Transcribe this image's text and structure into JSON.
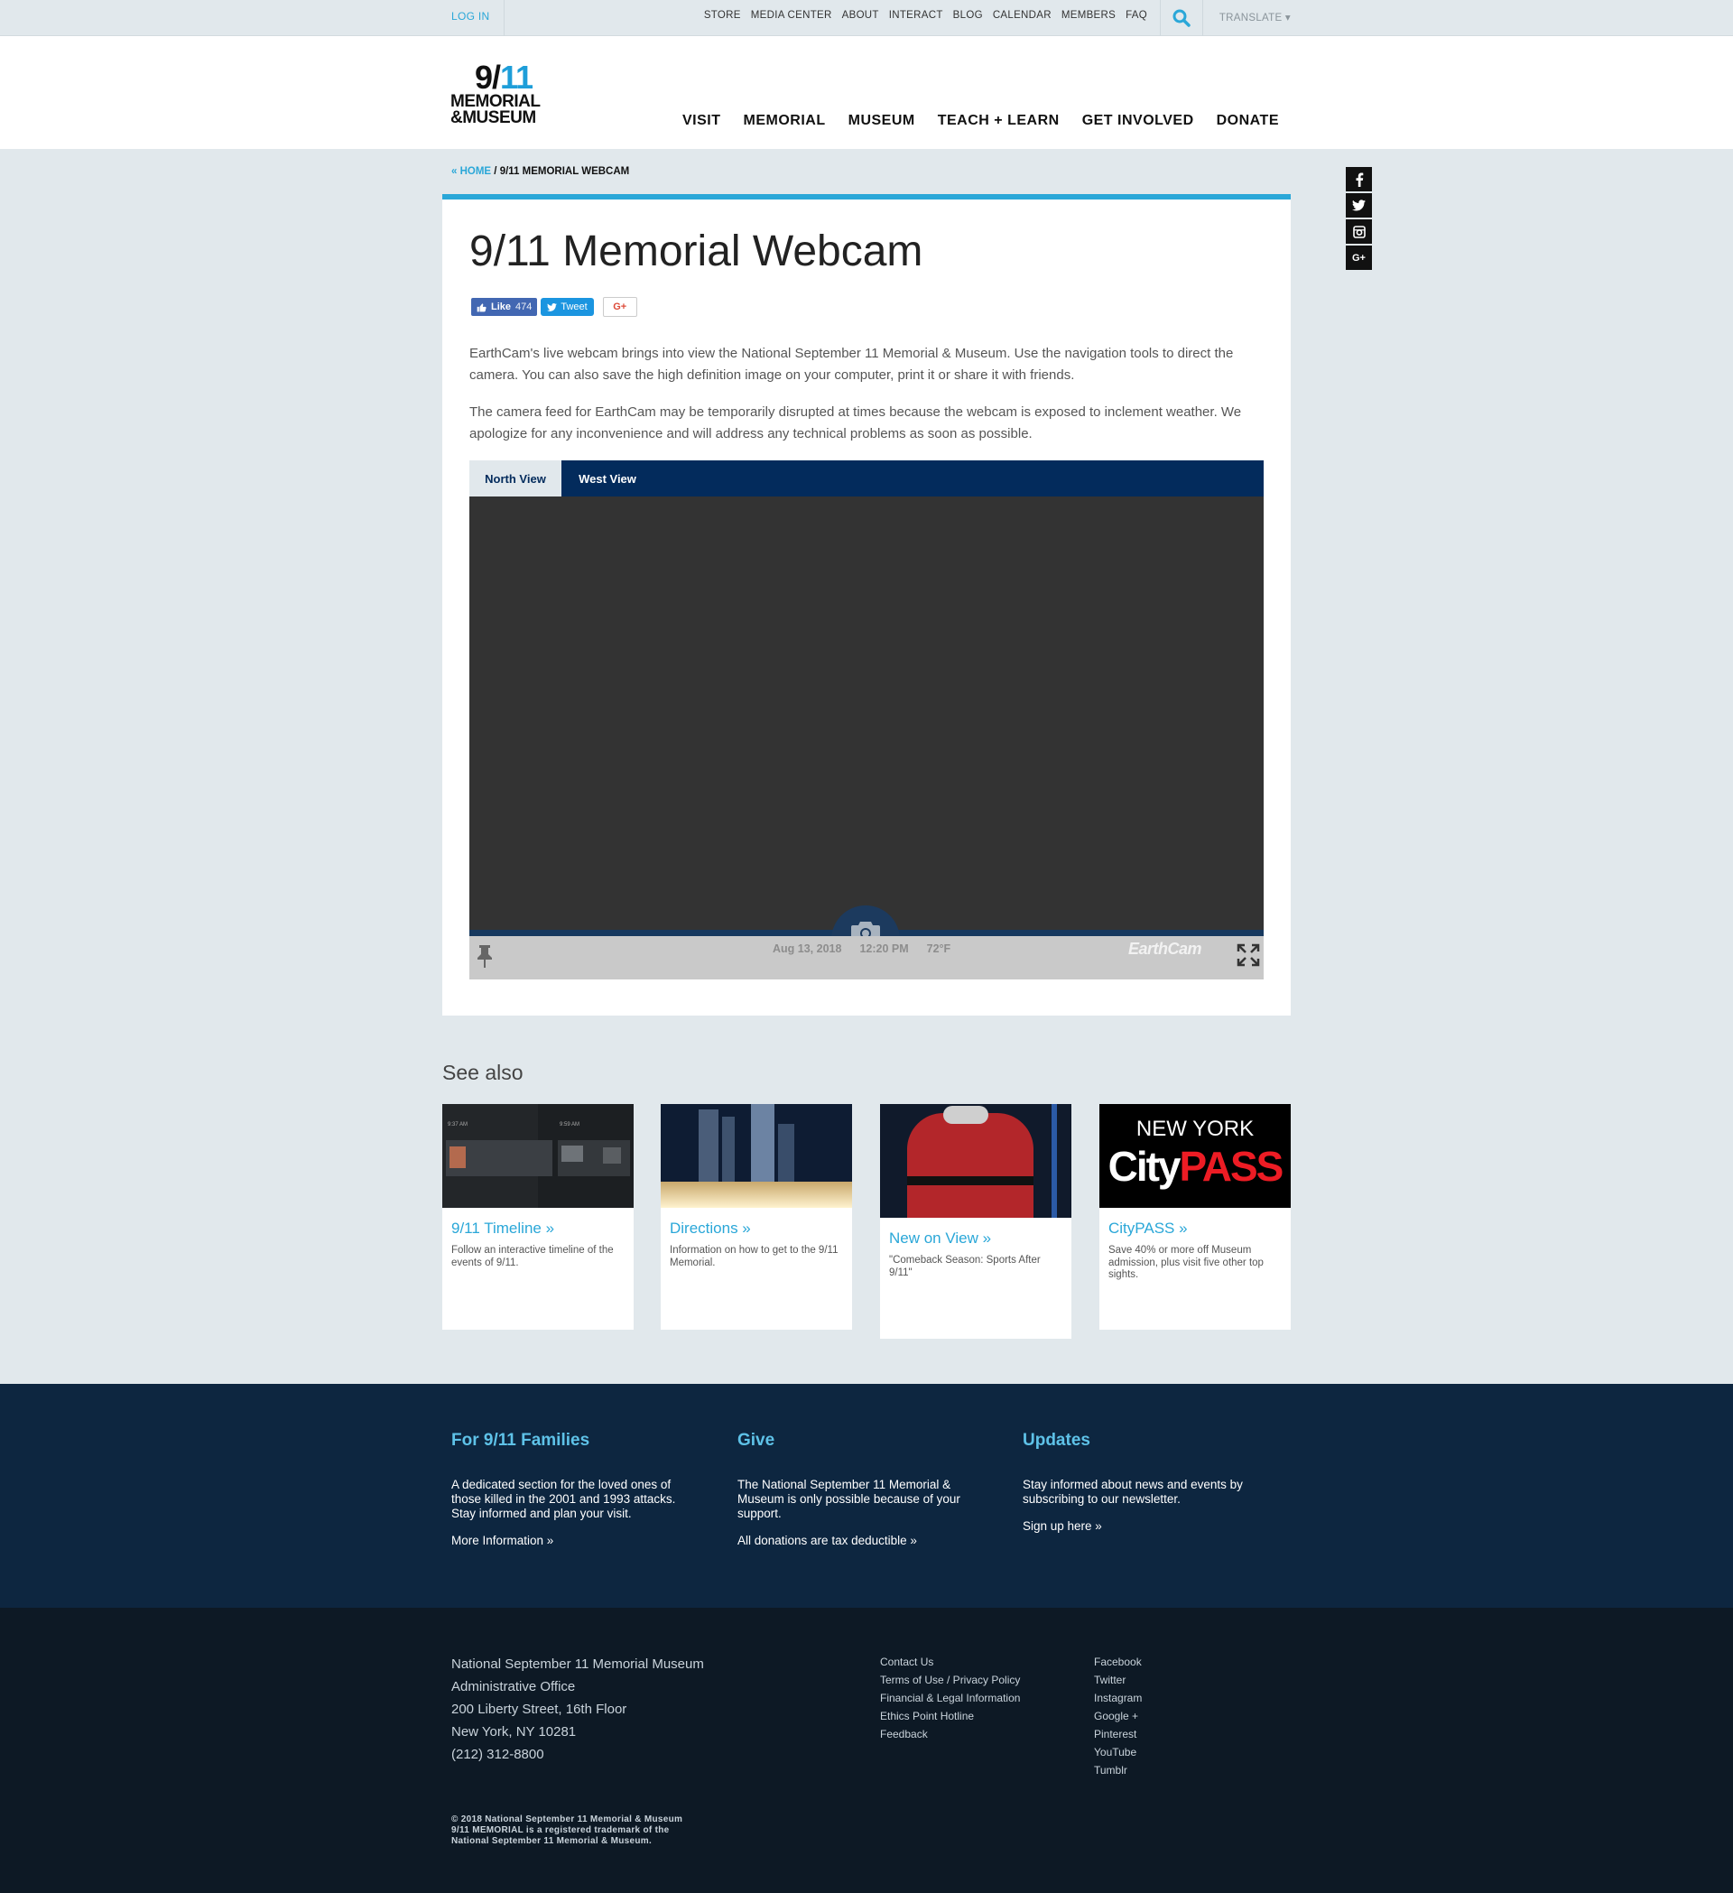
{
  "util": {
    "login": "LOG IN",
    "links": [
      "STORE",
      "MEDIA CENTER",
      "ABOUT",
      "INTERACT",
      "BLOG",
      "CALENDAR",
      "MEMBERS",
      "FAQ"
    ],
    "translate": "TRANSLATE ▾"
  },
  "logo": {
    "num_a": "9/",
    "num_b": "11",
    "line1": "MEMORIAL",
    "line2": "&MUSEUM"
  },
  "nav": [
    "VISIT",
    "MEMORIAL",
    "MUSEUM",
    "TEACH + LEARN",
    "GET INVOLVED",
    "DONATE"
  ],
  "breadcrumb": {
    "home": "« HOME",
    "sep": " / ",
    "current": "9/11 MEMORIAL WEBCAM"
  },
  "social": [
    "f",
    "t",
    "ig",
    "G+"
  ],
  "page": {
    "title": "9/11 Memorial Webcam",
    "share": {
      "like": "Like",
      "like_count": "474",
      "tweet": "Tweet",
      "gplus": "G+"
    },
    "p1": "EarthCam's live webcam brings into view the National September 11 Memorial & Museum. Use the navigation tools to direct the camera. You can also save the high definition image on your computer, print it or share it with friends.",
    "p2": "The camera feed for EarthCam may be temporarily disrupted at times because the webcam is exposed to inclement weather. We apologize for any inconvenience and will address any technical problems as soon as possible."
  },
  "webcam": {
    "tabs": [
      "North View",
      "West View"
    ],
    "active_tab": "North View",
    "date": "Aug 13, 2018",
    "time": "12:20 PM",
    "temp": "72°F",
    "brand": "EarthCam"
  },
  "see_also": {
    "heading": "See also",
    "cards": [
      {
        "title": "9/11 Timeline »",
        "desc": "Follow an interactive timeline of the events of 9/11."
      },
      {
        "title": "Directions »",
        "desc": "Information on how to get to the 9/11 Memorial."
      },
      {
        "title": "New on View »",
        "desc": "\"Comeback Season: Sports After 9/11\""
      },
      {
        "title": "CityPASS »",
        "desc": "Save 40% or more off Museum admission, plus visit five other top sights.",
        "logo_top": "NEW YORK",
        "logo_city": "City",
        "logo_pass": "PASS"
      }
    ],
    "timeline_thumb": {
      "t1": "9:37 AM",
      "t2": "9:59 AM"
    }
  },
  "families": [
    {
      "title": "For 9/11 Families",
      "text": "A dedicated section for the loved ones of those killed in the 2001 and 1993 attacks. Stay informed and plan your visit.",
      "link": "More Information »"
    },
    {
      "title": "Give",
      "text": "The National September 11 Memorial & Museum is only possible because of your support.",
      "link": "All donations are tax deductible »"
    },
    {
      "title": "Updates",
      "text": "Stay informed about news and events by subscribing to our newsletter.",
      "link": "Sign up here »"
    }
  ],
  "footer": {
    "address": [
      "National September 11 Memorial Museum",
      "Administrative Office",
      "200 Liberty Street, 16th Floor",
      "New York, NY 10281",
      "(212) 312-8800"
    ],
    "links1": [
      "Contact Us",
      "Terms of Use / Privacy Policy",
      "Financial & Legal Information",
      "Ethics Point Hotline",
      "Feedback"
    ],
    "links2": [
      "Facebook",
      "Twitter",
      "Instagram",
      "Google +",
      "Pinterest",
      "YouTube",
      "Tumblr"
    ],
    "copyright": [
      "© 2018 National September 11 Memorial & Museum",
      "9/11 MEMORIAL is a registered trademark of the",
      "National September 11 Memorial & Museum."
    ]
  },
  "colors": {
    "accent": "#2aa7d8",
    "navy": "#032b5c",
    "families_bg": "#0d2640",
    "footer_bg": "#0d1925"
  }
}
